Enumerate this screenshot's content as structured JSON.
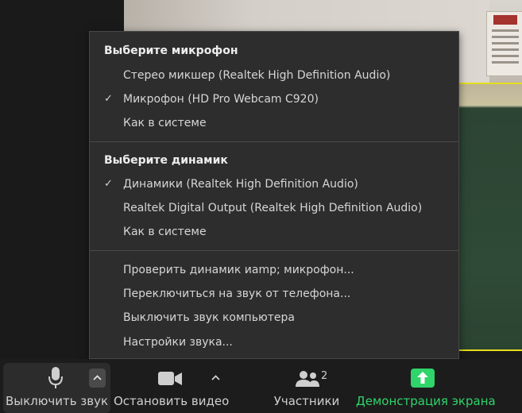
{
  "menu": {
    "mic_section": {
      "header": "Выберите микрофон",
      "items": [
        {
          "label": "Стерео микшер (Realtek High Definition Audio)",
          "checked": false
        },
        {
          "label": "Микрофон (HD Pro Webcam C920)",
          "checked": true
        },
        {
          "label": "Как в системе",
          "checked": false
        }
      ]
    },
    "speaker_section": {
      "header": "Выберите динамик",
      "items": [
        {
          "label": "Динамики (Realtek High Definition Audio)",
          "checked": true
        },
        {
          "label": "Realtek Digital Output (Realtek High Definition Audio)",
          "checked": false
        },
        {
          "label": "Как в системе",
          "checked": false
        }
      ]
    },
    "actions": [
      {
        "label": "Проверить динамик иamp; микрофон..."
      },
      {
        "label": "Переключиться на звук от телефона..."
      },
      {
        "label": "Выключить звук компьютера"
      },
      {
        "label": "Настройки звука..."
      }
    ],
    "check_glyph": "✓"
  },
  "toolbar": {
    "mute_label": "Выключить звук",
    "stop_video_label": "Остановить видео",
    "participants_label": "Участники",
    "participants_count": "2",
    "share_label": "Демонстрация экрана"
  },
  "colors": {
    "menu_bg": "#2d2d2d",
    "toolbar_bg": "#1c1c1c",
    "share_green": "#2fd46a",
    "active_speaker_border": "#e6de1a"
  },
  "icons": {
    "mic": "microphone-icon",
    "video": "video-camera-icon",
    "participants": "participants-icon",
    "share": "share-screen-icon",
    "caret": "chevron-up-icon",
    "check": "checkmark-icon"
  }
}
